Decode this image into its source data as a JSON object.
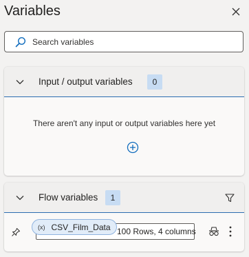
{
  "pane": {
    "title": "Variables",
    "close_icon": "close-icon"
  },
  "search": {
    "placeholder": "Search variables",
    "value": "",
    "icon": "search-icon"
  },
  "io_section": {
    "title": "Input / output variables",
    "count": "0",
    "empty_message": "There aren't any input or output variables here yet",
    "add_icon": "add-circle-icon"
  },
  "flow_section": {
    "title": "Flow variables",
    "count": "1",
    "filter_icon": "filter-icon",
    "variables": [
      {
        "type_glyph": "(x)",
        "name": "CSV_Film_Data",
        "value": "100 Rows, 4 columns"
      }
    ]
  },
  "colors": {
    "accent": "#2b6cb0",
    "badge": "#c7dcf3",
    "chip": "#e1ecf8"
  }
}
